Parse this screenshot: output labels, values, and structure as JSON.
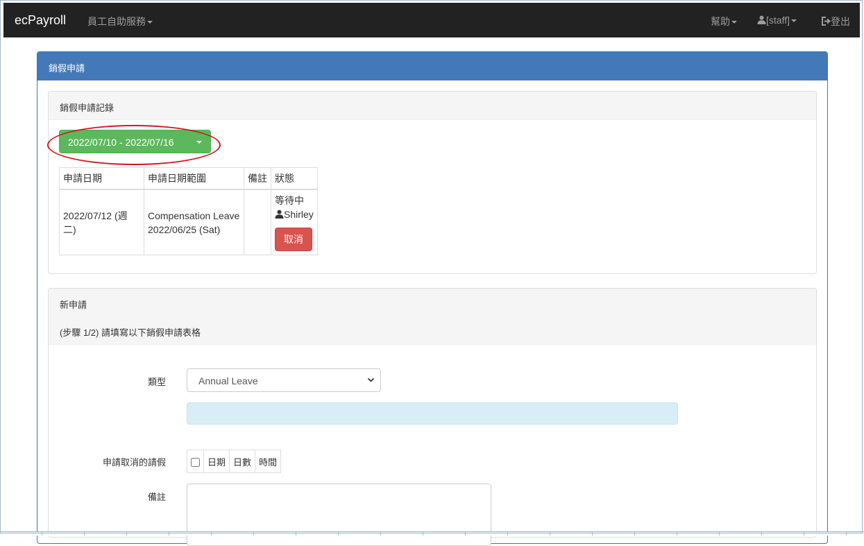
{
  "navbar": {
    "brand": "ecPayroll",
    "self_service": "員工自助服務",
    "help": "幫助",
    "user": "[staff]",
    "logout": "登出"
  },
  "panel": {
    "title": "銷假申請"
  },
  "records": {
    "title": "銷假申請記錄",
    "date_range": "2022/07/10 - 2022/07/16",
    "headers": [
      "申請日期",
      "申請日期範圍",
      "備註",
      "狀態"
    ],
    "row": {
      "apply_date": "2022/07/12 (週二)",
      "leave_type": "Compensation Leave",
      "leave_date": "2022/06/25 (Sat)",
      "remark": "",
      "status": "等待中",
      "approver": "Shirley",
      "cancel_label": "取消"
    }
  },
  "new_request": {
    "title": "新申請",
    "step_text": "(步驟 1/2) 請填寫以下銷假申請表格",
    "type_label": "類型",
    "type_value": "Annual Leave",
    "cancel_leave_label": "申請取消的請假",
    "cancel_table_headers": [
      "日期",
      "日數",
      "時間"
    ],
    "remark_label": "備註"
  }
}
